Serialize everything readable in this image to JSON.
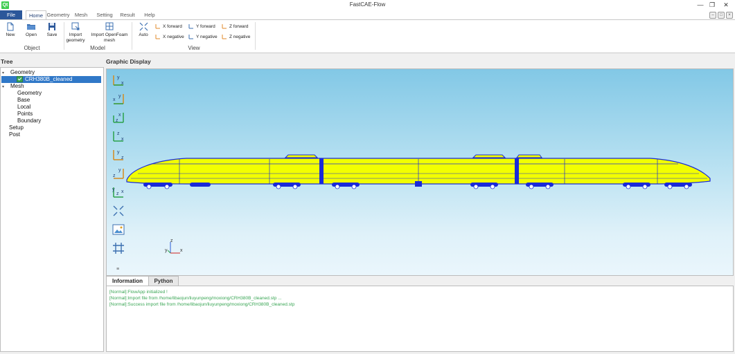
{
  "window": {
    "title": "FastCAE-Flow",
    "logo": "Qt"
  },
  "menu_tabs": [
    "File",
    "Home",
    "Geometry",
    "Mesh",
    "Setting",
    "Result",
    "Help"
  ],
  "ribbon": {
    "object_group": "Object",
    "model_group": "Model",
    "view_group": "View",
    "new_label": "New",
    "open_label": "Open",
    "save_label": "Save",
    "import_geometry_label": [
      "Import",
      "geometry"
    ],
    "import_openfoam_label": [
      "Import OpenFoam",
      "mesh"
    ],
    "auto_label": "Auto",
    "view_buttons": [
      "X forward",
      "Y forward",
      "Z forward",
      "X negative",
      "Y negative",
      "Z negative"
    ]
  },
  "tree": {
    "title": "Tree",
    "nodes": {
      "geometry": "Geometry",
      "geometry_child": "CRH380B_cleaned",
      "mesh": "Mesh",
      "mesh_children": [
        "Geometry",
        "Base",
        "Local",
        "Points",
        "Boundary"
      ],
      "setup": "Setup",
      "post": "Post"
    }
  },
  "graphic": {
    "title": "Graphic Display",
    "axis_labels": {
      "x": "x",
      "y": "y",
      "z": "z"
    }
  },
  "info": {
    "tabs": [
      "Information",
      "Python"
    ],
    "lines": [
      "[Normal]:FlowApp initialized !",
      "[Normal]:Import file from /home/libaojun/liuyunpeng/moxiong/CRH380B_cleaned.stp ...",
      "[Normal]:Success import file from /home/libaojun/liuyunpeng/moxiong/CRH380B_cleaned.stp"
    ]
  },
  "colors": {
    "file_tab": "#2b579a",
    "selection": "#3078c8",
    "train_body": "#f2ff00",
    "train_edges": "#1a2ad8",
    "log_text": "#3aa655"
  }
}
